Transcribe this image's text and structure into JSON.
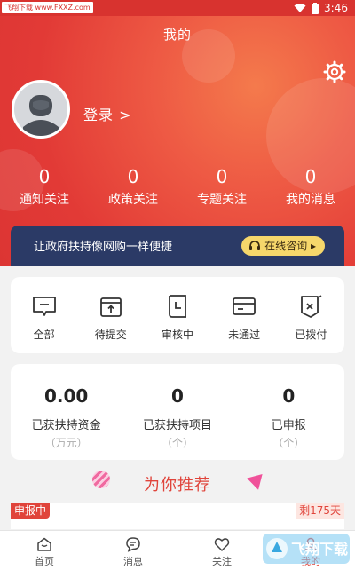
{
  "statusbar": {
    "badge": "飞翔下载 www.FXXZ.com",
    "time": "3:46"
  },
  "header": {
    "title": "我的"
  },
  "profile": {
    "login_label": "登录 >"
  },
  "stats": [
    {
      "value": "0",
      "label": "通知关注"
    },
    {
      "value": "0",
      "label": "政策关注"
    },
    {
      "value": "0",
      "label": "专题关注"
    },
    {
      "value": "0",
      "label": "我的消息"
    }
  ],
  "banner": {
    "text": "让政府扶持像网购一样便捷",
    "button": "在线咨询 ▸"
  },
  "status_items": [
    {
      "label": "全部",
      "icon": "message-box-icon"
    },
    {
      "label": "待提交",
      "icon": "upload-box-icon"
    },
    {
      "label": "审核中",
      "icon": "clock-doc-icon"
    },
    {
      "label": "未通过",
      "icon": "card-icon"
    },
    {
      "label": "已拨付",
      "icon": "cross-doc-icon"
    }
  ],
  "funds": [
    {
      "value": "0.00",
      "label": "已获扶持资金",
      "unit": "（万元）"
    },
    {
      "value": "0",
      "label": "已获扶持项目",
      "unit": "（个）"
    },
    {
      "value": "0",
      "label": "已申报",
      "unit": "（个）"
    }
  ],
  "recommend": {
    "title": "为你推荐"
  },
  "item": {
    "tag": "申报中",
    "remain": "剩175天"
  },
  "tabs": [
    {
      "label": "首页",
      "icon": "home-icon"
    },
    {
      "label": "消息",
      "icon": "chat-icon"
    },
    {
      "label": "关注",
      "icon": "heart-icon"
    },
    {
      "label": "我的",
      "icon": "user-icon"
    }
  ],
  "watermark": {
    "text": "飞翔下载"
  },
  "colors": {
    "brand_red": "#e0443b",
    "banner_navy": "#2b3a66",
    "consult_yellow": "#f6d76b"
  }
}
